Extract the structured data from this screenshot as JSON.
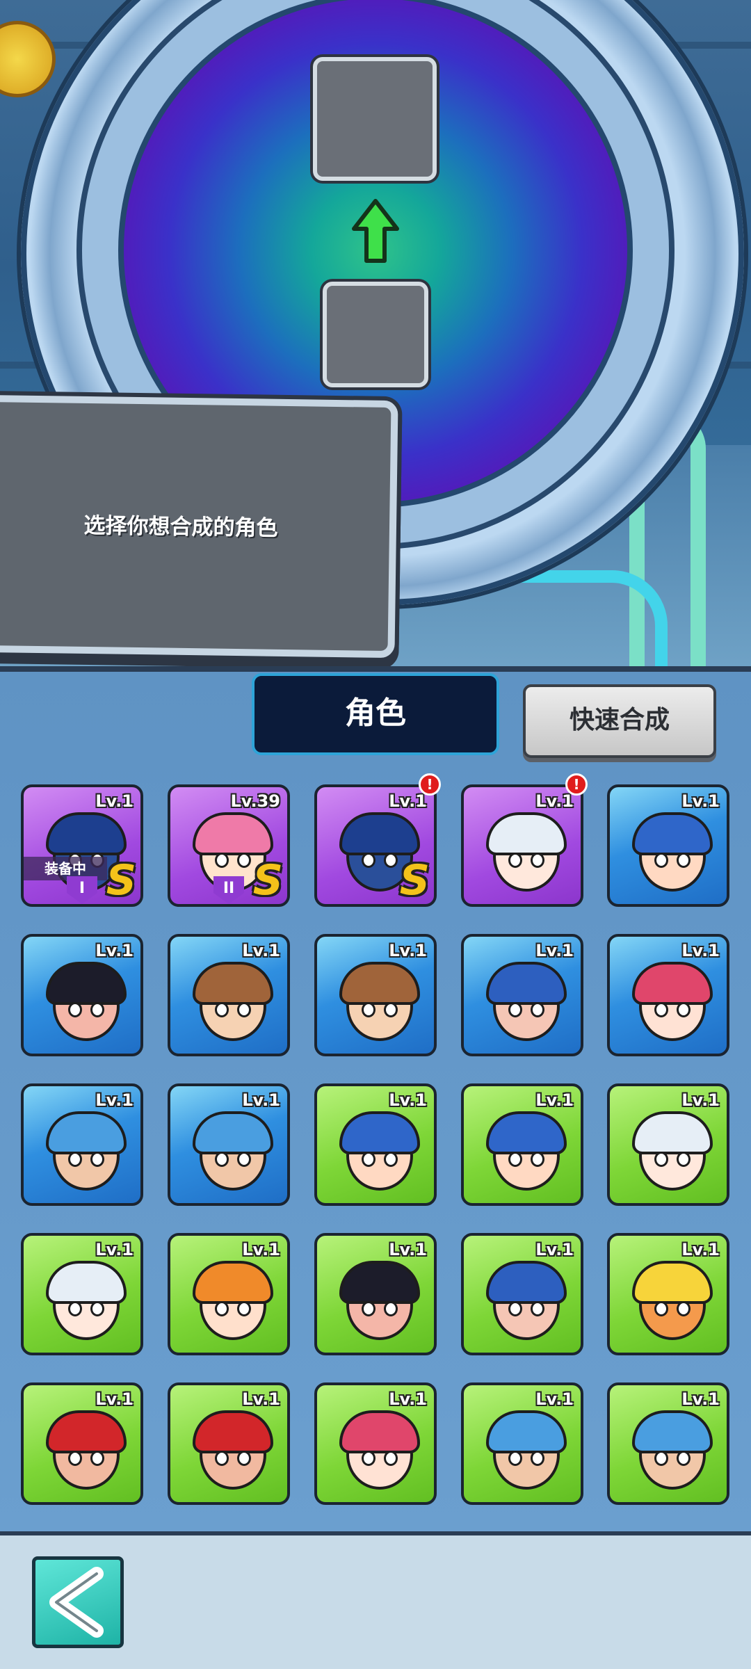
{
  "hint": {
    "text": "选择你想合成的角色"
  },
  "tabs": {
    "roles_label": "角色",
    "quick_synth_label": "快速合成"
  },
  "equipped_label": "装备中",
  "colors": {
    "purple": "#a149e0",
    "blue": "#2f8fe0",
    "green": "#7ed637",
    "accent": "#2ea4d8"
  },
  "characters": [
    {
      "level": "Lv.1",
      "rarity": "purple",
      "face": "masked-warrior",
      "hair": "#1d3f8f",
      "skin": "#2a4f9a",
      "equipped": true,
      "slot": "I",
      "s_badge": "S",
      "alert": false
    },
    {
      "level": "Lv.39",
      "rarity": "purple",
      "face": "pink-cap-girl",
      "hair": "#ef7aa8",
      "skin": "#ffe3cc",
      "equipped": false,
      "slot": "II",
      "s_badge": "S",
      "alert": false
    },
    {
      "level": "Lv.1",
      "rarity": "purple",
      "face": "masked-warrior",
      "hair": "#1d3f8f",
      "skin": "#2a4f9a",
      "equipped": false,
      "slot": "",
      "s_badge": "S",
      "alert": true,
      "alert_mark": "!"
    },
    {
      "level": "Lv.1",
      "rarity": "purple",
      "face": "silver-hair-headset",
      "hair": "#e6eef6",
      "skin": "#ffe8dc",
      "equipped": false,
      "slot": "",
      "s_badge": "",
      "alert": true,
      "alert_mark": "!"
    },
    {
      "level": "Lv.1",
      "rarity": "blue",
      "face": "blue-hair-girl",
      "hair": "#2f66c9",
      "skin": "#ffd9c2",
      "equipped": false,
      "slot": "",
      "s_badge": "",
      "alert": false
    },
    {
      "level": "Lv.1",
      "rarity": "blue",
      "face": "mustache-monocle",
      "hair": "#1c1c2a",
      "skin": "#f4b6a8",
      "equipped": false,
      "slot": "",
      "s_badge": "",
      "alert": false
    },
    {
      "level": "Lv.1",
      "rarity": "blue",
      "face": "cowboy",
      "hair": "#a0643a",
      "skin": "#f6d2b3",
      "equipped": false,
      "slot": "",
      "s_badge": "",
      "alert": false
    },
    {
      "level": "Lv.1",
      "rarity": "blue",
      "face": "cowboy",
      "hair": "#a0643a",
      "skin": "#f6d2b3",
      "equipped": false,
      "slot": "",
      "s_badge": "",
      "alert": false
    },
    {
      "level": "Lv.1",
      "rarity": "blue",
      "face": "big-chin-man",
      "hair": "#2d5fbf",
      "skin": "#f5c6b5",
      "equipped": false,
      "slot": "",
      "s_badge": "",
      "alert": false
    },
    {
      "level": "Lv.1",
      "rarity": "blue",
      "face": "pink-goggles-girl",
      "hair": "#e0466b",
      "skin": "#ffe2d4",
      "equipped": false,
      "slot": "",
      "s_badge": "",
      "alert": false
    },
    {
      "level": "Lv.1",
      "rarity": "blue",
      "face": "blue-creature",
      "hair": "#4a9ee0",
      "skin": "#f1c7a8",
      "equipped": false,
      "slot": "",
      "s_badge": "",
      "alert": false
    },
    {
      "level": "Lv.1",
      "rarity": "blue",
      "face": "blue-creature",
      "hair": "#4a9ee0",
      "skin": "#f1c7a8",
      "equipped": false,
      "slot": "",
      "s_badge": "",
      "alert": false
    },
    {
      "level": "Lv.1",
      "rarity": "green",
      "face": "blue-hair-girl",
      "hair": "#2f66c9",
      "skin": "#ffd9c2",
      "equipped": false,
      "slot": "",
      "s_badge": "",
      "alert": false
    },
    {
      "level": "Lv.1",
      "rarity": "green",
      "face": "blue-hair-girl",
      "hair": "#2f66c9",
      "skin": "#ffd9c2",
      "equipped": false,
      "slot": "",
      "s_badge": "",
      "alert": false
    },
    {
      "level": "Lv.1",
      "rarity": "green",
      "face": "silver-hair-headset",
      "hair": "#e6eef6",
      "skin": "#ffe8dc",
      "equipped": false,
      "slot": "",
      "s_badge": "",
      "alert": false
    },
    {
      "level": "Lv.1",
      "rarity": "green",
      "face": "silver-hair-headset",
      "hair": "#e6eef6",
      "skin": "#ffe8dc",
      "equipped": false,
      "slot": "",
      "s_badge": "",
      "alert": false
    },
    {
      "level": "Lv.1",
      "rarity": "green",
      "face": "bun-hair-girl",
      "hair": "#f08a2a",
      "skin": "#ffe0cc",
      "equipped": false,
      "slot": "",
      "s_badge": "",
      "alert": false
    },
    {
      "level": "Lv.1",
      "rarity": "green",
      "face": "mustache-monocle",
      "hair": "#1c1c2a",
      "skin": "#f4b6a8",
      "equipped": false,
      "slot": "",
      "s_badge": "",
      "alert": false
    },
    {
      "level": "Lv.1",
      "rarity": "green",
      "face": "big-chin-man",
      "hair": "#2d5fbf",
      "skin": "#f5c6b5",
      "equipped": false,
      "slot": "",
      "s_badge": "",
      "alert": false
    },
    {
      "level": "Lv.1",
      "rarity": "green",
      "face": "spiky-blond-beard",
      "hair": "#f7d43a",
      "skin": "#f49a4c",
      "equipped": false,
      "slot": "",
      "s_badge": "",
      "alert": false
    },
    {
      "level": "Lv.1",
      "rarity": "green",
      "face": "black-beard-pirate",
      "hair": "#d2262a",
      "skin": "#f1b9a0",
      "equipped": false,
      "slot": "",
      "s_badge": "",
      "alert": false
    },
    {
      "level": "Lv.1",
      "rarity": "green",
      "face": "black-beard-pirate",
      "hair": "#d2262a",
      "skin": "#f1b9a0",
      "equipped": false,
      "slot": "",
      "s_badge": "",
      "alert": false
    },
    {
      "level": "Lv.1",
      "rarity": "green",
      "face": "pink-goggles-girl",
      "hair": "#e0466b",
      "skin": "#ffe2d4",
      "equipped": false,
      "slot": "",
      "s_badge": "",
      "alert": false
    },
    {
      "level": "Lv.1",
      "rarity": "green",
      "face": "blue-creature",
      "hair": "#4a9ee0",
      "skin": "#f1c7a8",
      "equipped": false,
      "slot": "",
      "s_badge": "",
      "alert": false
    },
    {
      "level": "Lv.1",
      "rarity": "green",
      "face": "blue-creature",
      "hair": "#4a9ee0",
      "skin": "#f1c7a8",
      "equipped": false,
      "slot": "",
      "s_badge": "",
      "alert": false
    }
  ],
  "back_button": {
    "icon": "back-arrow-icon"
  }
}
